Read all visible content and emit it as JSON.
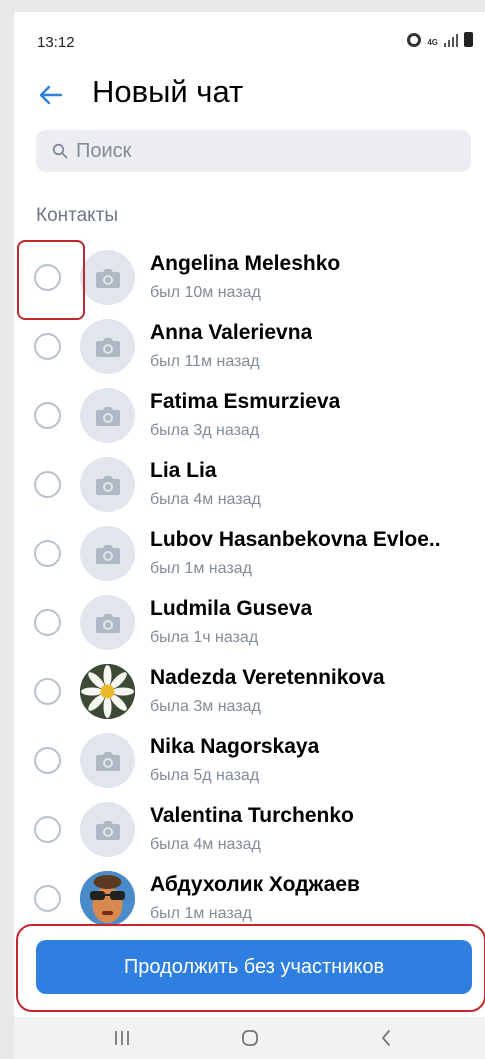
{
  "status_bar": {
    "time": "13:12",
    "network": "4G"
  },
  "header": {
    "title": "Новый чат"
  },
  "search": {
    "placeholder": "Поиск"
  },
  "contacts_section": {
    "label": "Контакты"
  },
  "contacts": [
    {
      "name": "Angelina Meleshko",
      "status": "был 10м назад",
      "avatar": "camera-placeholder"
    },
    {
      "name": "Anna Valerievna",
      "status": "был 11м назад",
      "avatar": "camera-placeholder"
    },
    {
      "name": "Fatima Esmurzieva",
      "status": "была 3д назад",
      "avatar": "camera-placeholder"
    },
    {
      "name": "Lia Lia",
      "status": "была 4м назад",
      "avatar": "camera-placeholder"
    },
    {
      "name": "Lubov Hasanbekovna Evloe..",
      "status": "был 1м назад",
      "avatar": "camera-placeholder"
    },
    {
      "name": "Ludmila Guseva",
      "status": "была 1ч назад",
      "avatar": "camera-placeholder"
    },
    {
      "name": "Nadezda Veretennikova",
      "status": "была 3м назад",
      "avatar": "daisy-photo"
    },
    {
      "name": "Nika Nagorskaya",
      "status": "была 5д назад",
      "avatar": "camera-placeholder"
    },
    {
      "name": "Valentina Turchenko",
      "status": "была 4м назад",
      "avatar": "camera-placeholder"
    },
    {
      "name": "Абдухолик Ходжаев",
      "status": "был 1м назад",
      "avatar": "person-photo"
    }
  ],
  "continue_button": {
    "label": "Продолжить без участников"
  },
  "colors": {
    "accent": "#2f7fe0",
    "highlight": "#c1272d",
    "secondary_text": "#818c99"
  },
  "nav_bar": {
    "items": [
      "recents-icon",
      "home-icon",
      "back-icon"
    ]
  }
}
